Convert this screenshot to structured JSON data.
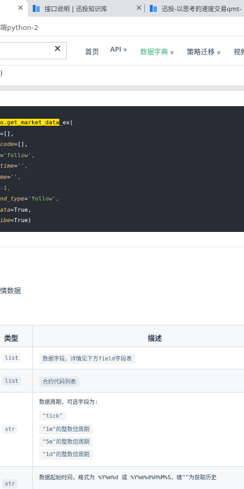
{
  "tabs": [
    {
      "label": "",
      "close": "✕"
    },
    {
      "label": "接口说明 | 迅投知识库",
      "close": "✕"
    },
    {
      "label": "迅投-以思考的速度交易qmt-（设"
    }
  ],
  "address": "端python-2",
  "nav": {
    "search_clear": "✕",
    "items": [
      "首页",
      "API",
      "数据字典",
      "策略迁移",
      "视频"
    ]
  },
  "breadcrumb": ")",
  "code": {
    "line1_hl": "o.get_market_data",
    "line1_rest": "_ex(",
    "lines": [
      {
        "k": "",
        "eq": "=[],",
        "v": ""
      },
      {
        "k": "code",
        "eq": "=[],",
        "v": ""
      },
      {
        "k": "",
        "eq": "=",
        "v": "'follow',"
      },
      {
        "k": "time",
        "eq": "=",
        "v": "'',"
      },
      {
        "k": "me",
        "eq": "=",
        "v": "'',"
      },
      {
        "k": "",
        "eq": "-1,",
        "v": ""
      },
      {
        "k": "nd_type",
        "eq": "=",
        "v": "'follow',"
      },
      {
        "k": "ata",
        "eq": "=True,",
        "v": ""
      },
      {
        "k": "ibe",
        "eq": "=True)",
        "v": ""
      }
    ]
  },
  "section_text": "情数据",
  "table": {
    "headers": [
      "类型",
      "描述"
    ],
    "rows": [
      {
        "type": "list",
        "desc": [
          "数据字段，详情见下方field字段表"
        ]
      },
      {
        "type": "list",
        "desc": [
          "合约代码列表"
        ]
      },
      {
        "type": "str",
        "desc": [
          "数据周期，可选字段为:",
          "\"tick\"",
          "\"1m\"的整数倍周期",
          "\"5m\"的整数倍周期",
          "\"1d\"的整数倍周期"
        ]
      },
      {
        "type": "str",
        "desc": [
          "数据起始时间，格式为 %Y%m%d 或 %Y%m%d%H%M%S，填\"\"为获取历史"
        ]
      }
    ]
  },
  "colors": {
    "accent": "#3eaf7c",
    "code_bg": "#282c34",
    "highlight": "#ffe60a"
  }
}
